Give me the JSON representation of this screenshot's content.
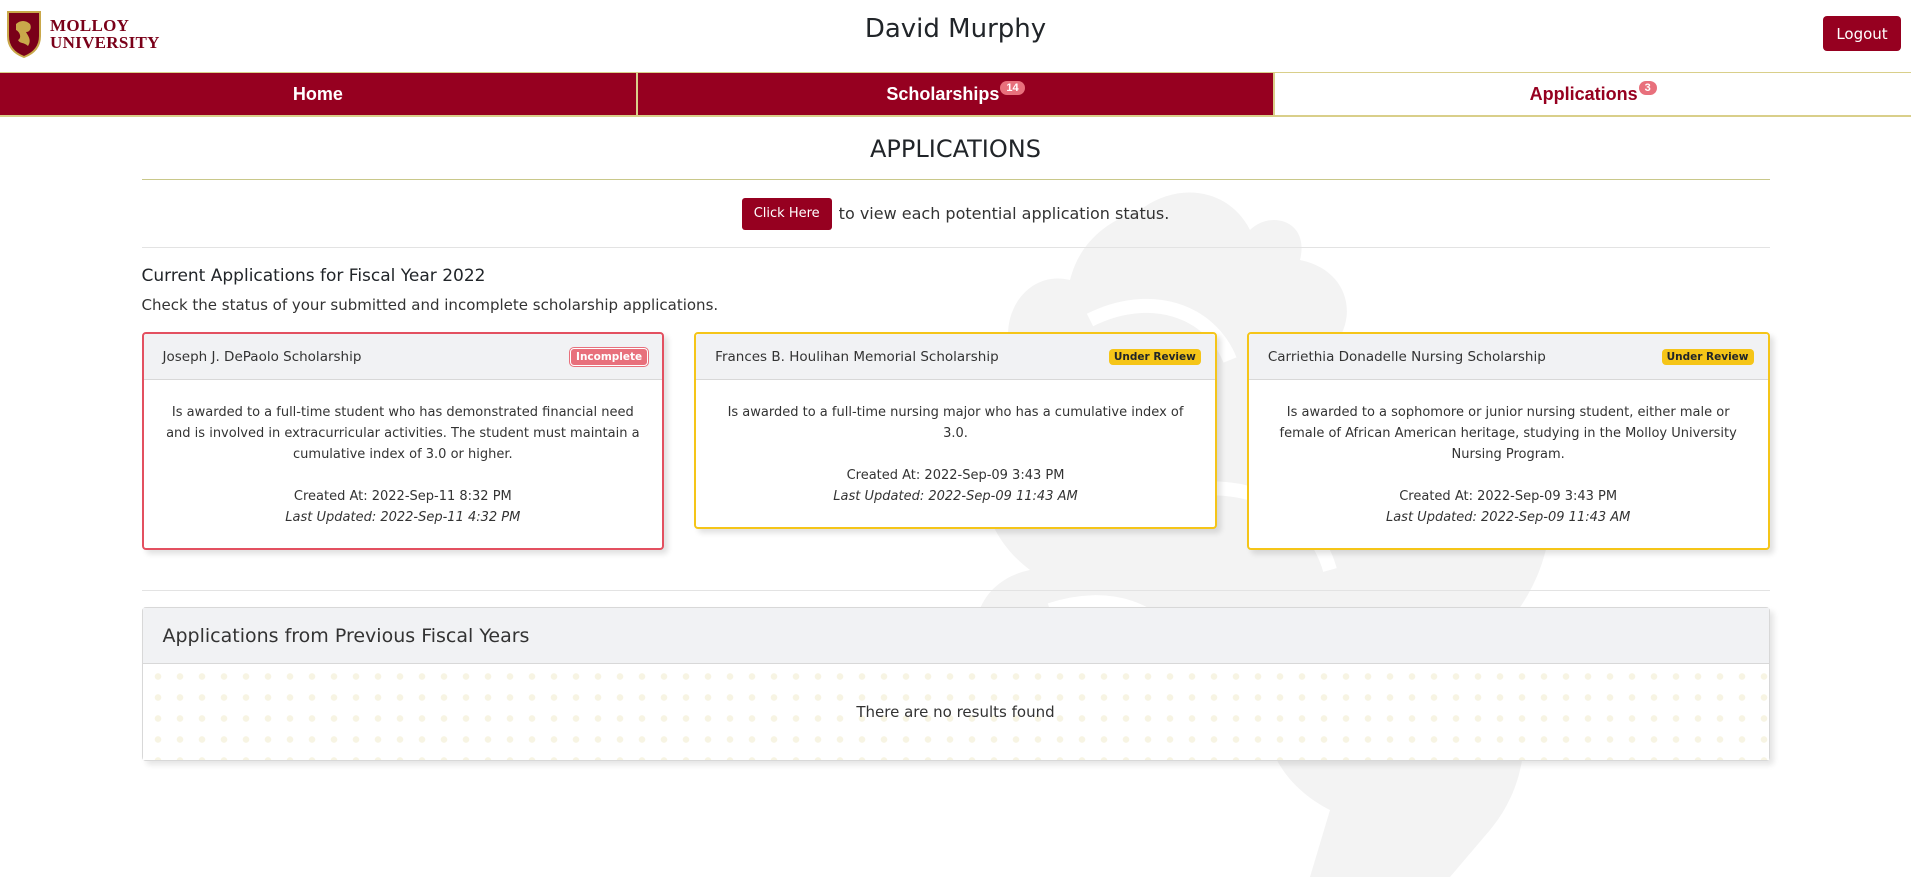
{
  "brand": {
    "logo_line1": "MOLLOY",
    "logo_line2": "UNIVERSITY",
    "primary_color": "#960020",
    "accent_color": "#d9cf8a"
  },
  "header": {
    "user_name": "David Murphy",
    "logout_label": "Logout"
  },
  "tabs": [
    {
      "label": "Home",
      "badge": "",
      "active": false
    },
    {
      "label": "Scholarships",
      "badge": "14",
      "active": false
    },
    {
      "label": "Applications",
      "badge": "3",
      "active": true
    }
  ],
  "page": {
    "title": "APPLICATIONS",
    "status_button_label": "Click Here",
    "status_text": "to view each potential application status."
  },
  "current": {
    "heading": "Current Applications for Fiscal Year 2022",
    "description": "Check the status of your submitted and incomplete scholarship applications.",
    "cards": [
      {
        "title": "Joseph J. DePaolo Scholarship",
        "status": "Incomplete",
        "status_color": "#e8707c",
        "description": "Is awarded to a full-time student who has demonstrated financial need and is involved in extracurricular activities. The student must maintain a cumulative index of 3.0 or higher.",
        "created": "Created At: 2022-Sep-11 8:32 PM",
        "updated": "Last Updated: 2022-Sep-11 4:32 PM"
      },
      {
        "title": "Frances B. Houlihan Memorial Scholarship",
        "status": "Under Review",
        "status_color": "#f5c518",
        "description": "Is awarded to a full-time nursing major who has a cumulative index of 3.0.",
        "created": "Created At: 2022-Sep-09 3:43 PM",
        "updated": "Last Updated: 2022-Sep-09 11:43 AM"
      },
      {
        "title": "Carriethia Donadelle Nursing Scholarship",
        "status": "Under Review",
        "status_color": "#f5c518",
        "description": "Is awarded to a sophomore or junior nursing student, either male or female of African American heritage, studying in the Molloy University Nursing Program.",
        "created": "Created At: 2022-Sep-09 3:43 PM",
        "updated": "Last Updated: 2022-Sep-09 11:43 AM"
      }
    ]
  },
  "previous": {
    "heading": "Applications from Previous Fiscal Years",
    "empty_text": "There are no results found"
  }
}
